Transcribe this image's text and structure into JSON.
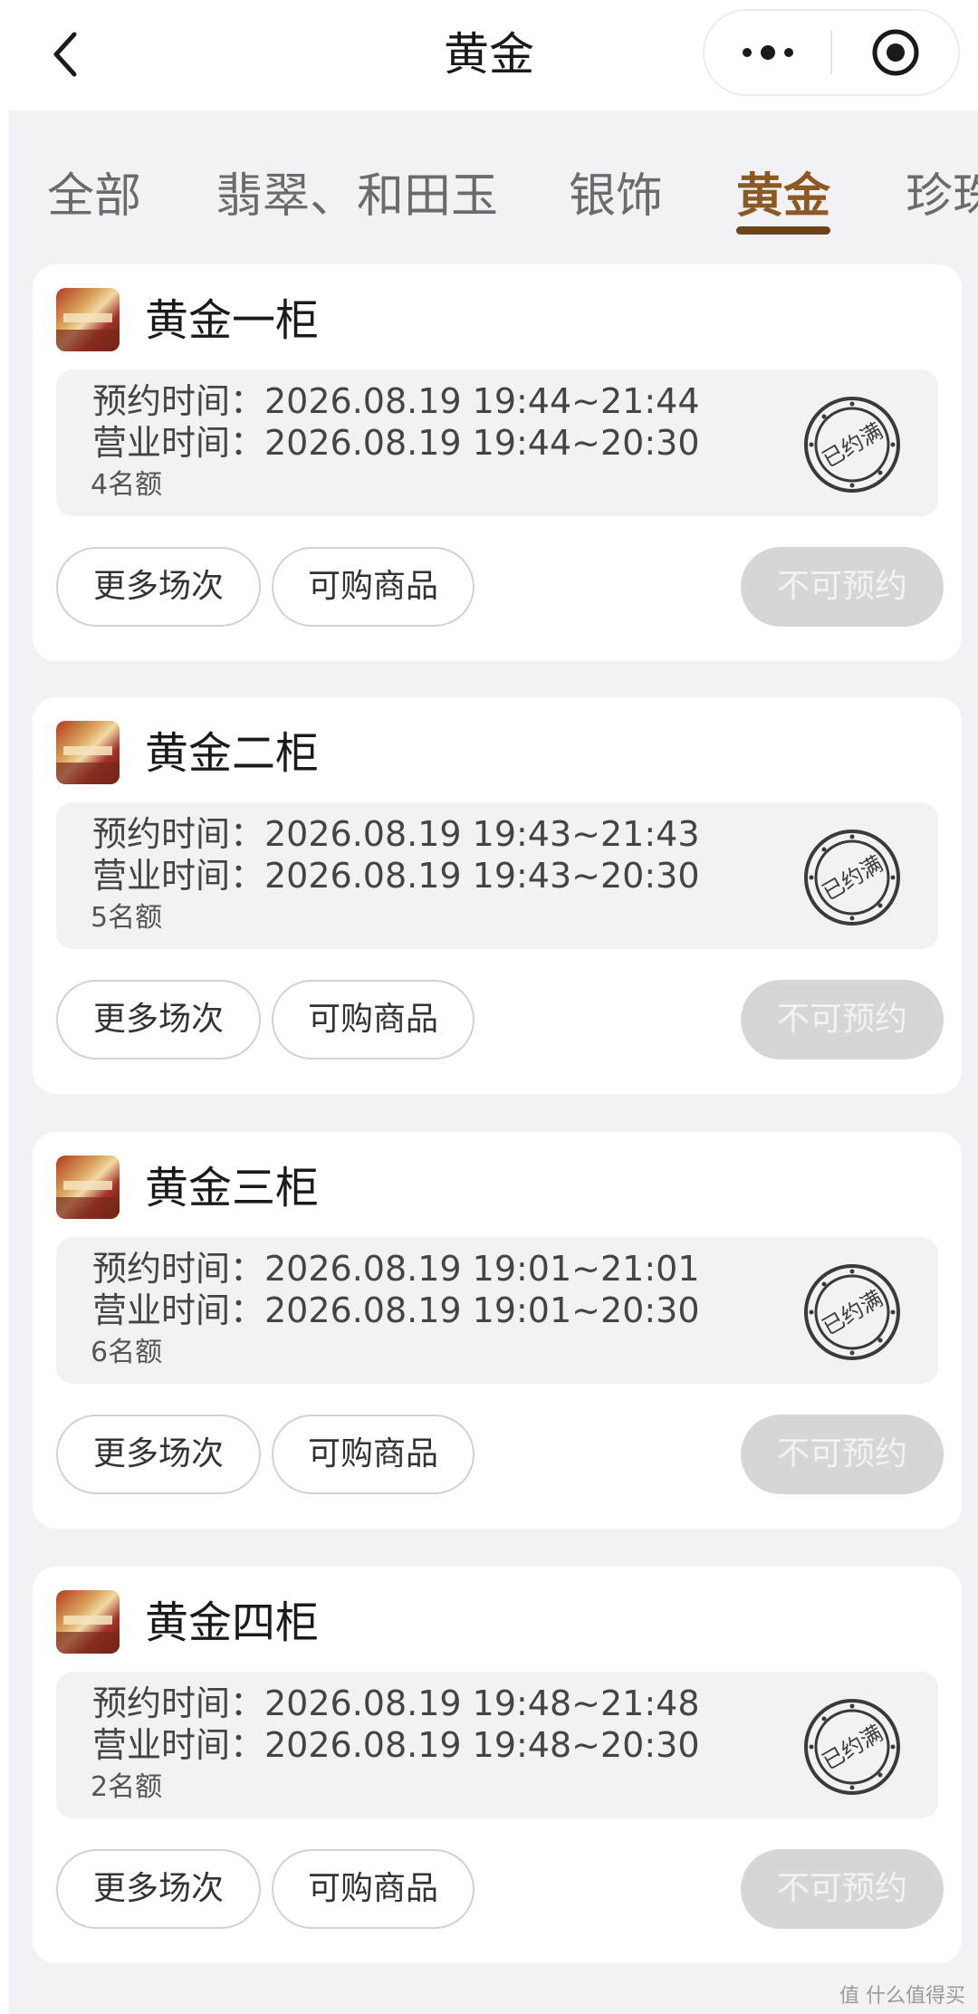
{
  "navbar": {
    "title": "黄金",
    "back_icon": "chevron-left-icon",
    "menu_icon": "more-dots-icon",
    "close_icon": "target-circle-icon"
  },
  "tabs": [
    {
      "label": "全部",
      "active": false
    },
    {
      "label": "翡翠、和田玉",
      "active": false
    },
    {
      "label": "银饰",
      "active": false
    },
    {
      "label": "黄金",
      "active": true
    },
    {
      "label": "珍珠",
      "active": false
    }
  ],
  "colors": {
    "accent": "#8b5a24",
    "underline": "#6b4419",
    "background": "#f1f1f6",
    "disabled_button": "#d6d6d6"
  },
  "counters": [
    {
      "name": "黄金一柜",
      "reserve_time": "预约时间：2026.08.19 19:44~21:44",
      "business_time": "营业时间：2026.08.19 19:44~20:30",
      "quota": "4名额",
      "stamp": "已约满",
      "more_sessions": "更多场次",
      "goods": "可购商品",
      "status_button": "不可预约"
    },
    {
      "name": "黄金二柜",
      "reserve_time": "预约时间：2026.08.19 19:43~21:43",
      "business_time": "营业时间：2026.08.19 19:43~20:30",
      "quota": "5名额",
      "stamp": "已约满",
      "more_sessions": "更多场次",
      "goods": "可购商品",
      "status_button": "不可预约"
    },
    {
      "name": "黄金三柜",
      "reserve_time": "预约时间：2026.08.19 19:01~21:01",
      "business_time": "营业时间：2026.08.19 19:01~20:30",
      "quota": "6名额",
      "stamp": "已约满",
      "more_sessions": "更多场次",
      "goods": "可购商品",
      "status_button": "不可预约"
    },
    {
      "name": "黄金四柜",
      "reserve_time": "预约时间：2026.08.19 19:48~21:48",
      "business_time": "营业时间：2026.08.19 19:48~20:30",
      "quota": "2名额",
      "stamp": "已约满",
      "more_sessions": "更多场次",
      "goods": "可购商品",
      "status_button": "不可预约"
    }
  ],
  "watermark": "值 什么值得买"
}
